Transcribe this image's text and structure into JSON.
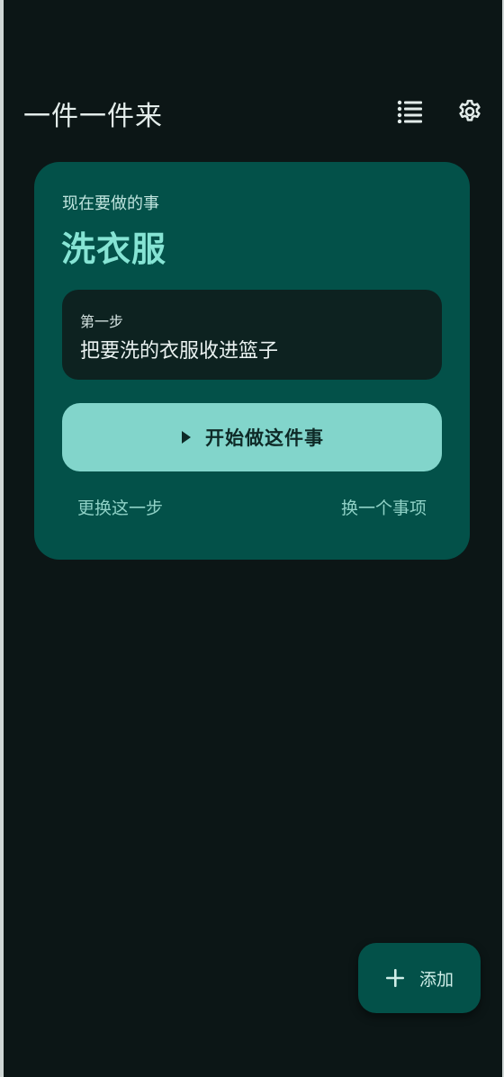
{
  "app_bar": {
    "title": "一件一件来",
    "icons": [
      "list-icon",
      "settings-icon"
    ]
  },
  "card": {
    "label": "现在要做的事",
    "task_title": "洗衣服",
    "step": {
      "label": "第一步",
      "text": "把要洗的衣服收进篮子"
    },
    "start_button": "开始做这件事",
    "change_step": "更换这一步",
    "change_task": "换一个事项"
  },
  "fab": {
    "label": "添加",
    "icon": "plus-icon"
  },
  "colors": {
    "background": "#0c1616",
    "card": "#035149",
    "accent": "#86e4d4",
    "button": "#82d5cb",
    "step_box": "#0d2220"
  }
}
